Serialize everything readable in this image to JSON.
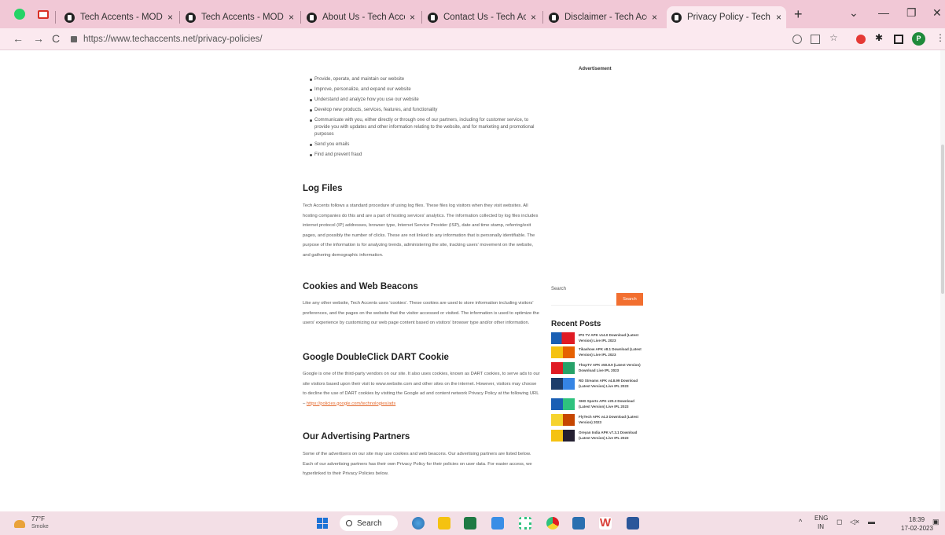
{
  "browser": {
    "tabs": [
      {
        "label": "Tech Accents - MOD APK",
        "active": false
      },
      {
        "label": "Tech Accents - MOD APK",
        "active": false
      },
      {
        "label": "About Us - Tech Accents",
        "active": false
      },
      {
        "label": "Contact Us - Tech Accents",
        "active": false
      },
      {
        "label": "Disclaimer - Tech Accents",
        "active": false
      },
      {
        "label": "Privacy Policy - Tech Accents",
        "active": true
      }
    ],
    "tab_close": "×",
    "new_tab": "+",
    "url": "https://www.techaccents.net/privacy-policies/",
    "profile_initial": "P",
    "accent": "#f1c8d6"
  },
  "page": {
    "advertisement": "Advertisement",
    "bullets": [
      "Provide, operate, and maintain our website",
      "Improve, personalize, and expand our website",
      "Understand and analyze how you use our website",
      "Develop new products, services, features, and functionality",
      "Communicate with you, either directly or through one of our partners, including for customer service, to provide you with updates and other information relating to the website, and for marketing and promotional purposes",
      "Send you emails",
      "Find and prevent fraud"
    ],
    "sections": {
      "log_files": {
        "title": "Log Files",
        "text": "Tech Accents follows a standard procedure of using log files. These files log visitors when they visit websites. All hosting companies do this and are a part of hosting services' analytics. The information collected by log files includes internet protocol (IP) addresses, browser type, Internet Service Provider (ISP), date and time stamp, referring/exit pages, and possibly the number of clicks. These are not linked to any information that is personally identifiable. The purpose of the information is for analyzing trends, administering the site, tracking users' movement on the website, and gathering demographic information."
      },
      "cookies": {
        "title": "Cookies and Web Beacons",
        "text": "Like any other website, Tech Accents uses 'cookies'. These cookies are used to store information including visitors' preferences, and the pages on the website that the visitor accessed or visited. The information is used to optimize the users' experience by customizing our web page content based on visitors' browser type and/or other information."
      },
      "dart": {
        "title": "Google DoubleClick DART Cookie",
        "text": "Google is one of the third-party vendors on our site. It also uses cookies, known as DART cookies, to serve ads to our site visitors based upon their visit to www.website.com and other sites on the internet. However, visitors may choose to decline the use of DART cookies by visiting the Google ad and content network Privacy Policy at the following URL –",
        "link": "https://policies.google.com/technologies/ads"
      },
      "partners": {
        "title": "Our Advertising Partners",
        "text": "Some of the advertisers on our site may use cookies and web beacons. Our advertising partners are listed below. Each of our advertising partners has their own Privacy Policy for their policies on user data. For easier access, we hyperlinked to their Privacy Policies below."
      }
    },
    "sidebar": {
      "search_label": "Search",
      "search_button": "Search",
      "recent_title": "Recent Posts",
      "posts": [
        {
          "title": "IPS TV APK v14.0 Download (Latest Version) Live IPL 2023"
        },
        {
          "title": "Tikashow APK v8.1 Download (Latest Version) Live IPL 2023"
        },
        {
          "title": "ThopTV APK v50.8.9 (Latest Version) Download Live IPL 2023"
        },
        {
          "title": "RD Streams APK v4.8.99 Download (Latest Version) Live IPL 2023"
        },
        {
          "title": "SHD Sports APK v20.3 Download (Latest Version) Live IPL 2023"
        },
        {
          "title": "FlyTech APK v4.3 Download (Latest Version) 2023"
        },
        {
          "title": "Oreyan India APK v7.3.1 Download (Latest Version) Live IPL 2023"
        }
      ]
    }
  },
  "taskbar": {
    "temperature": "77°F",
    "condition": "Smoke",
    "search": "Search",
    "lang_top": "ENG",
    "lang_bottom": "IN",
    "time": "18:39",
    "date": "17-02-2023"
  }
}
